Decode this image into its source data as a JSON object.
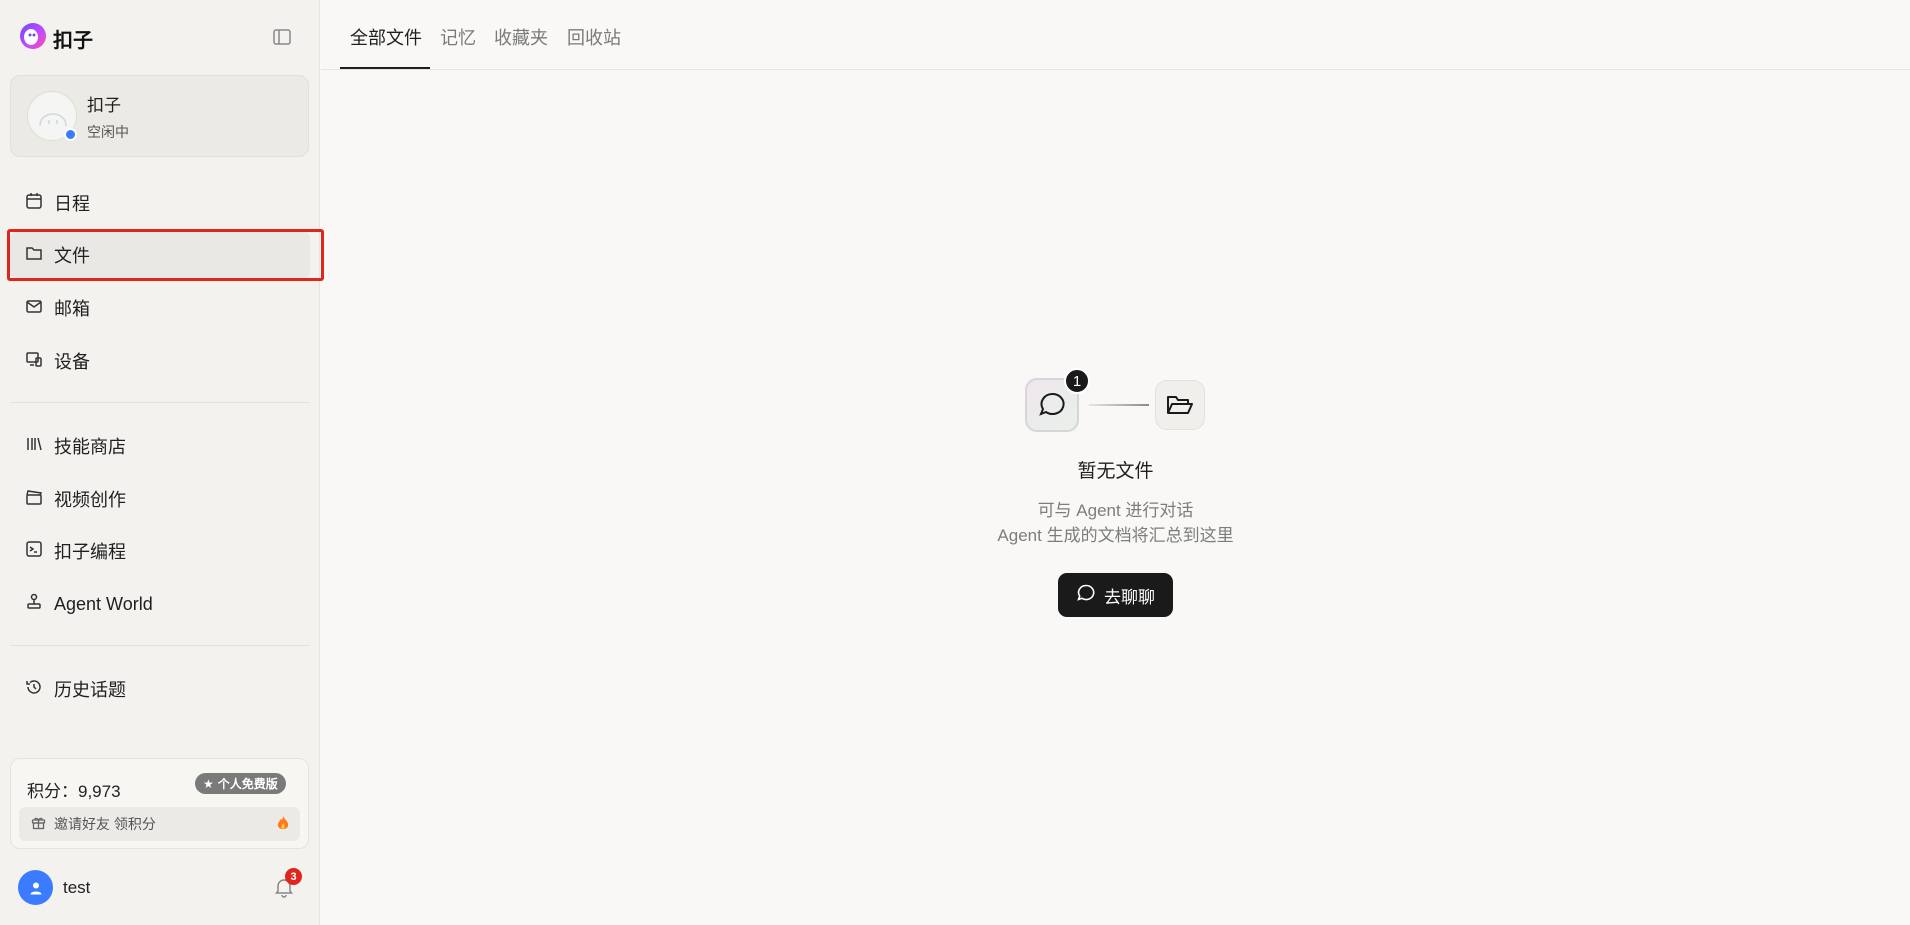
{
  "brand": {
    "name": "扣子"
  },
  "agent": {
    "name": "扣子",
    "status": "空闲中"
  },
  "nav": {
    "items": [
      {
        "label": "日程",
        "icon": "calendar-icon"
      },
      {
        "label": "文件",
        "icon": "folder-icon"
      },
      {
        "label": "邮箱",
        "icon": "mail-icon"
      },
      {
        "label": "设备",
        "icon": "devices-icon"
      },
      {
        "label": "技能商店",
        "icon": "library-icon"
      },
      {
        "label": "视频创作",
        "icon": "clapperboard-icon"
      },
      {
        "label": "扣子编程",
        "icon": "terminal-icon"
      },
      {
        "label": "Agent World",
        "icon": "joystick-icon"
      },
      {
        "label": "历史话题",
        "icon": "history-icon"
      }
    ]
  },
  "points": {
    "label": "积分：9,973",
    "plan": "个人免费版",
    "invite": "邀请好友 领积分"
  },
  "user": {
    "name": "test",
    "notifications": "3"
  },
  "tabs": [
    {
      "label": "全部文件"
    },
    {
      "label": "记忆"
    },
    {
      "label": "收藏夹"
    },
    {
      "label": "回收站"
    }
  ],
  "empty_state": {
    "badge_count": "1",
    "title": "暂无文件",
    "line1": "可与 Agent 进行对话",
    "line2": "Agent 生成的文档将汇总到这里",
    "button": "去聊聊"
  },
  "colors": {
    "accent": "#3a7bff",
    "highlight": "#e0251d",
    "dark_button": "#1a1a1a"
  }
}
